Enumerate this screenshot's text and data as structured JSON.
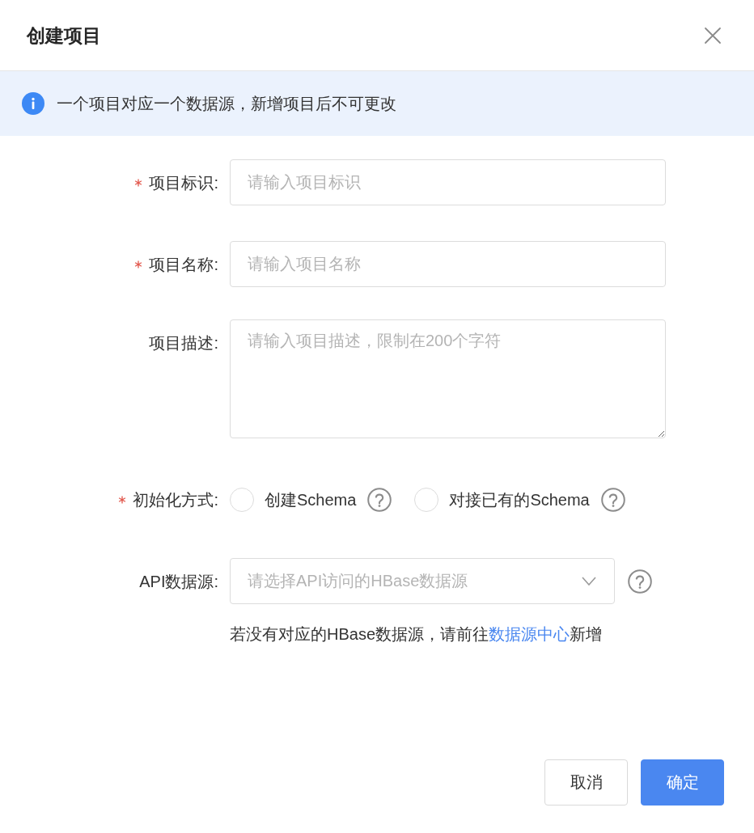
{
  "dialog": {
    "title": "创建项目"
  },
  "alert": {
    "text": "一个项目对应一个数据源，新增项目后不可更改"
  },
  "form": {
    "fields": [
      {
        "kind": "input",
        "required": true,
        "label": "项目标识:",
        "placeholder": "请输入项目标识"
      },
      {
        "kind": "input",
        "required": true,
        "label": "项目名称:",
        "placeholder": "请输入项目名称"
      },
      {
        "kind": "textarea",
        "required": false,
        "label": "项目描述:",
        "placeholder": "请输入项目描述，限制在200个字符"
      },
      {
        "kind": "radio",
        "required": true,
        "label": "初始化方式:",
        "options": [
          {
            "label": "创建Schema",
            "selected": false,
            "help": true
          },
          {
            "label": "对接已有的Schema",
            "selected": false,
            "help": true
          }
        ]
      },
      {
        "kind": "select",
        "required": false,
        "label": "API数据源:",
        "placeholder": "请选择API访问的HBase数据源",
        "help": true,
        "hint": {
          "before": "若没有对应的HBase数据源，请前往",
          "link": "数据源中心",
          "after": "新增"
        }
      }
    ]
  },
  "buttons": [
    {
      "label": "取消",
      "kind": "default"
    },
    {
      "label": "确定",
      "kind": "primary"
    }
  ]
}
